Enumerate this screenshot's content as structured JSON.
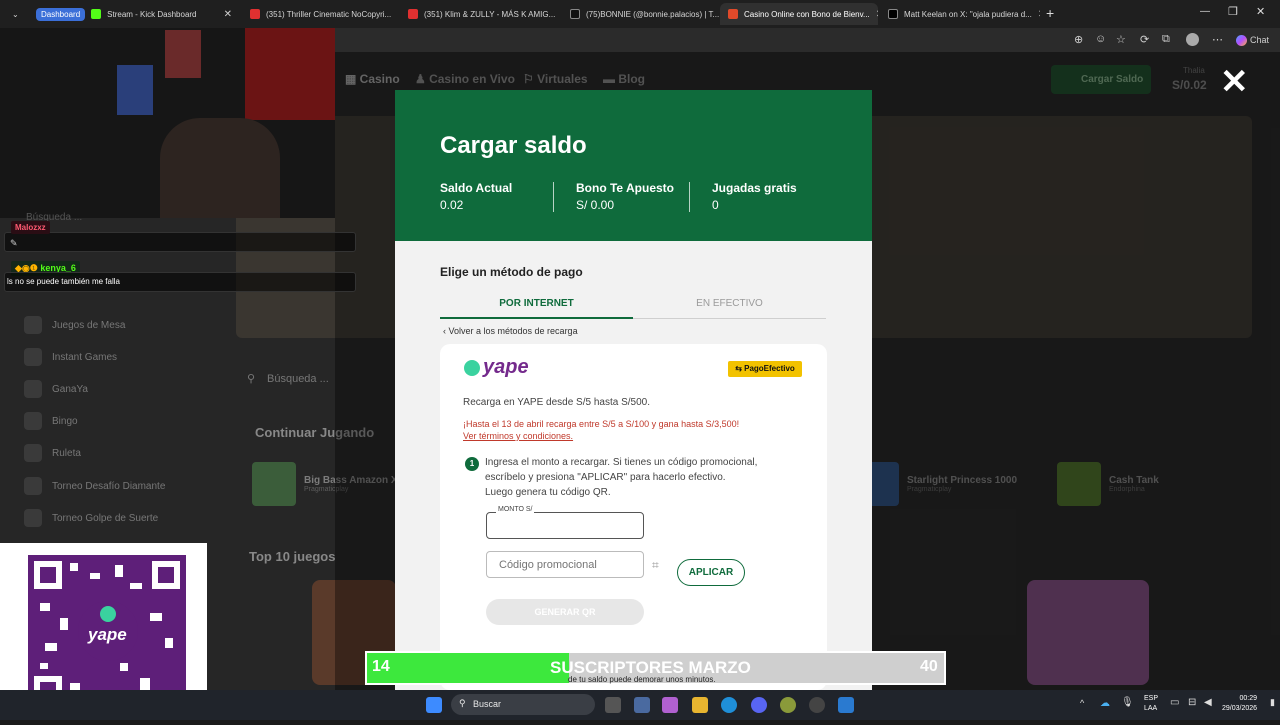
{
  "browser": {
    "tabs": [
      {
        "label": "Stream - Kick Dashboard",
        "badge": "Dashboard"
      },
      {
        "label": "(351) Thriller Cinematic NoCopyri..."
      },
      {
        "label": "(351) Klim & ZULLY - MÁS K AMIG..."
      },
      {
        "label": "(75)BONNIE (@bonnie.palacios) | T..."
      },
      {
        "label": "Casino Online con Bono de Bienv..."
      },
      {
        "label": "Matt Keelan on X: \"ojala pudiera d..."
      }
    ],
    "chat_label": "Chat"
  },
  "site": {
    "nav": [
      "Casino",
      "Casino en Vivo",
      "Virtuales",
      "Blog"
    ],
    "cargar_saldo": "Cargar Saldo",
    "user": "Thalia",
    "balance": "S/0.02",
    "search_placeholder": "Búsqueda ...",
    "sidebar": [
      "Juegos de Mesa",
      "Instant Games",
      "GanaYa",
      "Bingo",
      "Ruleta",
      "Torneo Desafío Diamante",
      "Torneo Golpe de Suerte"
    ],
    "section_continuar": "Continuar Jugando",
    "section_top10": "Top 10 juegos",
    "games": [
      {
        "title": "Big Bass Amazon Xt...",
        "provider": "Pragmaticplay"
      },
      {
        "title": "Starlight Princess 1000",
        "provider": "Pragmaticplay"
      },
      {
        "title": "Cash Tank",
        "provider": "Endorphina"
      }
    ]
  },
  "modal": {
    "title": "Cargar saldo",
    "stats": [
      {
        "label": "Saldo Actual",
        "value": "0.02"
      },
      {
        "label": "Bono Te Apuesto",
        "value": "S/ 0.00"
      },
      {
        "label": "Jugadas gratis",
        "value": "0"
      }
    ],
    "heading": "Elige un método de pago",
    "tabs": {
      "internet": "POR INTERNET",
      "efectivo": "EN EFECTIVO"
    },
    "back": "Volver a los métodos de recarga",
    "card": {
      "logo": "yape",
      "badge": "PagoEfectivo",
      "desc": "Recarga en YAPE desde S/5 hasta S/500.",
      "promo": "¡Hasta el 13 de abril recarga entre S/5 a S/100 y gana hasta S/3,500!",
      "terms": "Ver términos y condiciones.",
      "step_number": "1",
      "step_lines": [
        "Ingresa el monto a recargar. Si tienes un código promocional,",
        "escríbelo y presiona \"APLICAR\" para hacerlo efectivo.",
        "Luego genera tu código QR."
      ],
      "monto_label": "MONTO S/",
      "promo_placeholder": "Código promocional",
      "aplicar": "APLICAR",
      "generar": "GENERAR QR"
    }
  },
  "stream": {
    "chat": [
      {
        "user": "Malozxz",
        "text": ""
      },
      {
        "user": "kenya_6",
        "text": "ls no se puede también me falla"
      }
    ],
    "sub_goal": {
      "current": "14",
      "title": "SUSCRIPTORES MARZO",
      "target": "40",
      "progress": 0.35
    },
    "sub_caption": "de tu saldo puede demorar unos minutos.",
    "qr_brand": "yape"
  },
  "taskbar": {
    "search": "Buscar",
    "lang": [
      "ESP",
      "LAA"
    ],
    "time": "00:29",
    "date": "29/03/2026"
  },
  "colors": {
    "brand_green": "#0f6b3c",
    "yape_purple": "#742a8c",
    "goal_green": "#3de83d"
  }
}
